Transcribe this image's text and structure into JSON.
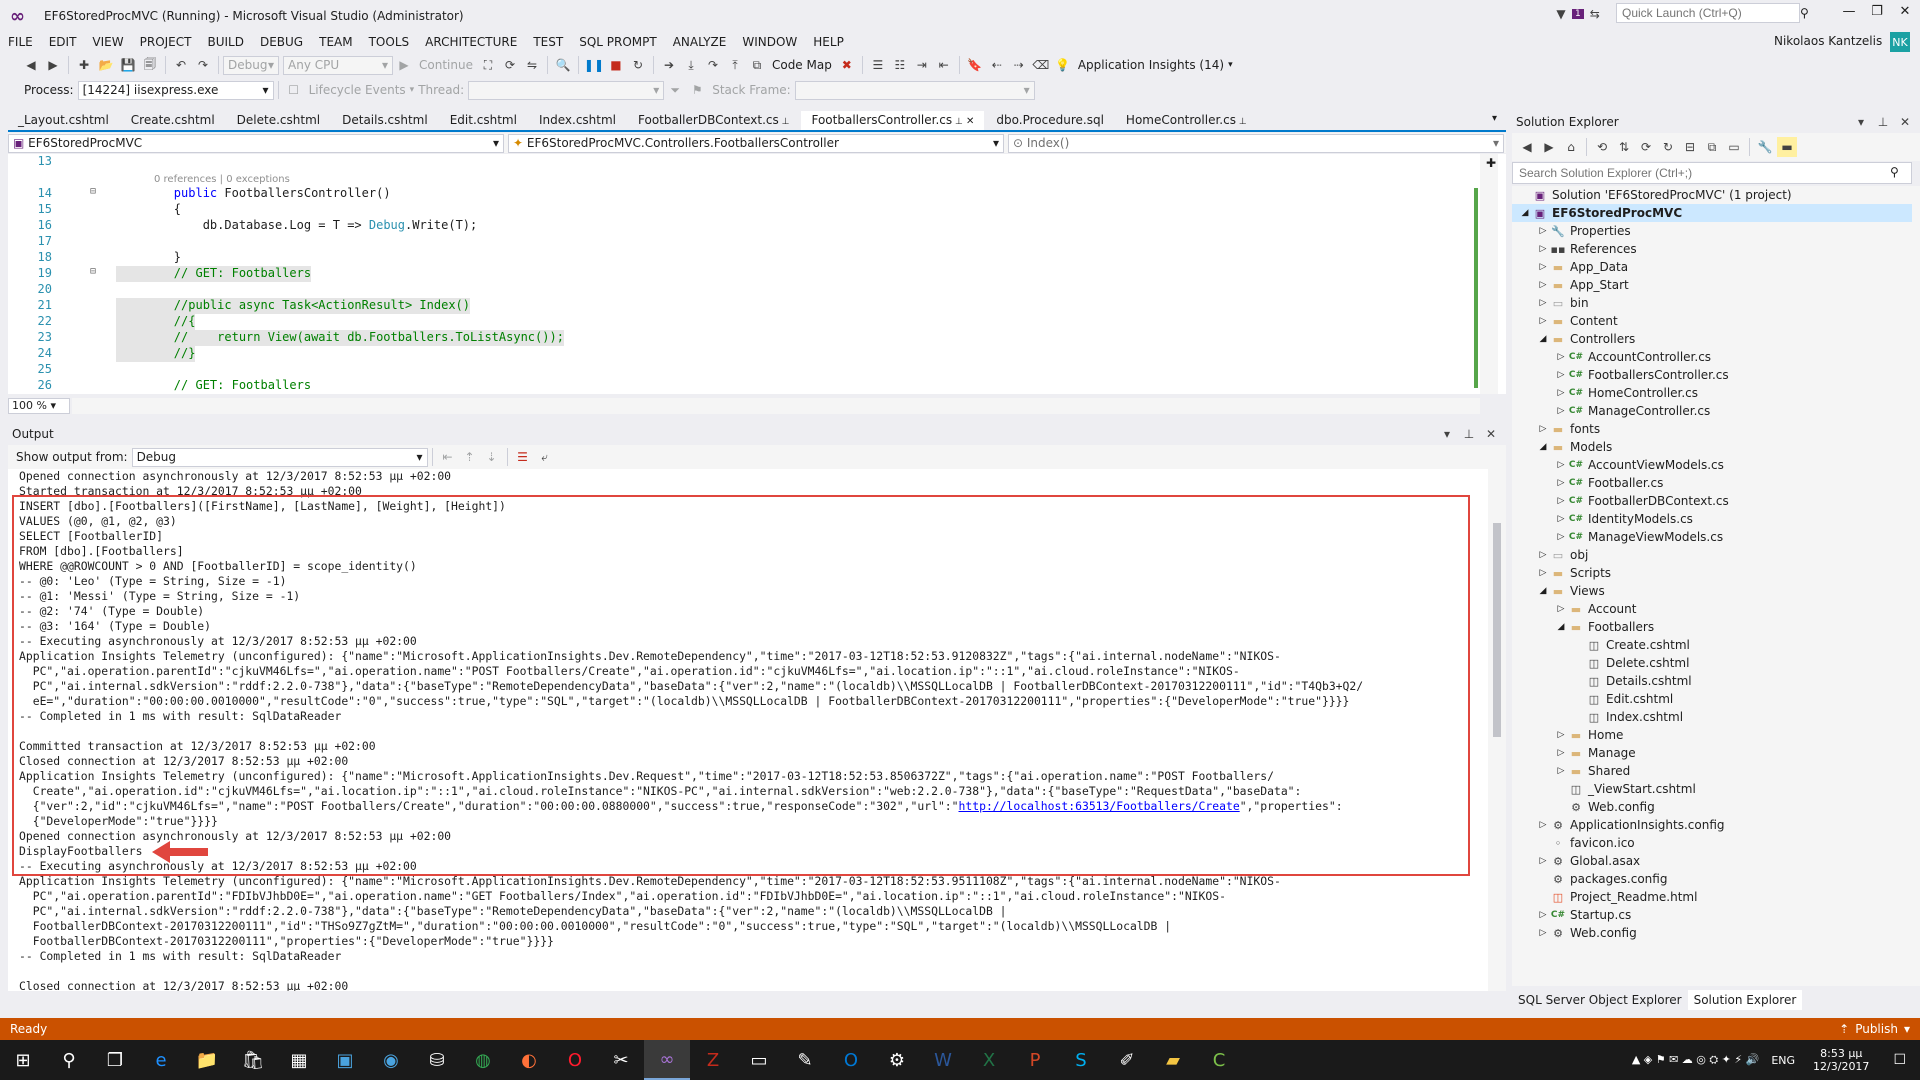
{
  "window": {
    "title": "EF6StoredProcMVC (Running) - Microsoft Visual Studio (Administrator)",
    "notification_count": "1",
    "quick_launch_placeholder": "Quick Launch (Ctrl+Q)",
    "user_name": "Nikolaos Kantzelis",
    "user_initials": "NK"
  },
  "menu": [
    "FILE",
    "EDIT",
    "VIEW",
    "PROJECT",
    "BUILD",
    "DEBUG",
    "TEAM",
    "TOOLS",
    "ARCHITECTURE",
    "TEST",
    "SQL PROMPT",
    "ANALYZE",
    "WINDOW",
    "HELP"
  ],
  "toolbar": {
    "config": "Debug",
    "platform": "Any CPU",
    "continue_label": "Continue",
    "code_map_label": "Code Map",
    "app_insights_label": "Application Insights (14)",
    "process_label": "Process:",
    "process_value": "[14224] iisexpress.exe",
    "lifecycle_label": "Lifecycle Events",
    "thread_label": "Thread:",
    "stack_frame_label": "Stack Frame:"
  },
  "doc_tabs": [
    "_Layout.cshtml",
    "Create.cshtml",
    "Delete.cshtml",
    "Details.cshtml",
    "Edit.cshtml",
    "Index.cshtml",
    "FootballerDBContext.cs",
    "FootballersController.cs",
    "dbo.Procedure.sql",
    "HomeController.cs"
  ],
  "nav": {
    "project": "EF6StoredProcMVC",
    "class": "EF6StoredProcMVC.Controllers.FootballersController",
    "member": "Index()"
  },
  "code": {
    "lens": "0 references | 0 exceptions",
    "lines": [
      {
        "n": "13",
        "text": ""
      },
      {
        "n": "14",
        "text": "        public FootballersController()"
      },
      {
        "n": "15",
        "text": "        {"
      },
      {
        "n": "16",
        "text": "            db.Database.Log = T => Debug.Write(T);"
      },
      {
        "n": "17",
        "text": ""
      },
      {
        "n": "18",
        "text": "        }"
      },
      {
        "n": "19",
        "text": "        // GET: Footballers"
      },
      {
        "n": "20",
        "text": ""
      },
      {
        "n": "21",
        "text": "        //public async Task<ActionResult> Index()"
      },
      {
        "n": "22",
        "text": "        //{"
      },
      {
        "n": "23",
        "text": "        //    return View(await db.Footballers.ToListAsync());"
      },
      {
        "n": "24",
        "text": "        //}"
      },
      {
        "n": "25",
        "text": ""
      },
      {
        "n": "26",
        "text": "        // GET: Footballers"
      }
    ],
    "zoom": "100 %"
  },
  "output": {
    "title": "Output",
    "show_from_label": "Show output from:",
    "source": "Debug",
    "lines": [
      "Opened connection asynchronously at 12/3/2017 8:52:53 μμ +02:00",
      "Started transaction at 12/3/2017 8:52:53 μμ +02:00",
      "INSERT [dbo].[Footballers]([FirstName], [LastName], [Weight], [Height])",
      "VALUES (@0, @1, @2, @3)",
      "SELECT [FootballerID]",
      "FROM [dbo].[Footballers]",
      "WHERE @@ROWCOUNT > 0 AND [FootballerID] = scope_identity()",
      "-- @0: 'Leo' (Type = String, Size = -1)",
      "-- @1: 'Messi' (Type = String, Size = -1)",
      "-- @2: '74' (Type = Double)",
      "-- @3: '164' (Type = Double)",
      "-- Executing asynchronously at 12/3/2017 8:52:53 μμ +02:00",
      "Application Insights Telemetry (unconfigured): {\"name\":\"Microsoft.ApplicationInsights.Dev.RemoteDependency\",\"time\":\"2017-03-12T18:52:53.9120832Z\",\"tags\":{\"ai.internal.nodeName\":\"NIKOS-",
      "  PC\",\"ai.operation.parentId\":\"cjkuVM46Lfs=\",\"ai.operation.name\":\"POST Footballers/Create\",\"ai.operation.id\":\"cjkuVM46Lfs=\",\"ai.location.ip\":\"::1\",\"ai.cloud.roleInstance\":\"NIKOS-",
      "  PC\",\"ai.internal.sdkVersion\":\"rddf:2.2.0-738\"},\"data\":{\"baseType\":\"RemoteDependencyData\",\"baseData\":{\"ver\":2,\"name\":\"(localdb)\\\\MSSQLLocalDB | FootballerDBContext-20170312200111\",\"id\":\"T4Qb3+Q2/",
      "  eE=\",\"duration\":\"00:00:00.0010000\",\"resultCode\":\"0\",\"success\":true,\"type\":\"SQL\",\"target\":\"(localdb)\\\\MSSQLLocalDB | FootballerDBContext-20170312200111\",\"properties\":{\"DeveloperMode\":\"true\"}}}}",
      "-- Completed in 1 ms with result: SqlDataReader",
      "",
      "Committed transaction at 12/3/2017 8:52:53 μμ +02:00",
      "Closed connection at 12/3/2017 8:52:53 μμ +02:00",
      "Application Insights Telemetry (unconfigured): {\"name\":\"Microsoft.ApplicationInsights.Dev.Request\",\"time\":\"2017-03-12T18:52:53.8506372Z\",\"tags\":{\"ai.operation.name\":\"POST Footballers/",
      "  Create\",\"ai.operation.id\":\"cjkuVM46Lfs=\",\"ai.location.ip\":\"::1\",\"ai.cloud.roleInstance\":\"NIKOS-PC\",\"ai.internal.sdkVersion\":\"web:2.2.0-738\"},\"data\":{\"baseType\":\"RequestData\",\"baseData\":",
      "  {\"ver\":2,\"id\":\"cjkuVM46Lfs=\",\"name\":\"POST Footballers/Create\",\"duration\":\"00:00:00.0880000\",\"success\":true,\"responseCode\":\"302\",\"url\":\"",
      "  {\"DeveloperMode\":\"true\"}}}}",
      "Opened connection asynchronously at 12/3/2017 8:52:53 μμ +02:00",
      "DisplayFootballers",
      "-- Executing asynchronously at 12/3/2017 8:52:53 μμ +02:00",
      "Application Insights Telemetry (unconfigured): {\"name\":\"Microsoft.ApplicationInsights.Dev.RemoteDependency\",\"time\":\"2017-03-12T18:52:53.9511108Z\",\"tags\":{\"ai.internal.nodeName\":\"NIKOS-",
      "  PC\",\"ai.operation.parentId\":\"FDIbVJhbD0E=\",\"ai.operation.name\":\"GET Footballers/Index\",\"ai.operation.id\":\"FDIbVJhbD0E=\",\"ai.location.ip\":\"::1\",\"ai.cloud.roleInstance\":\"NIKOS-",
      "  PC\",\"ai.internal.sdkVersion\":\"rddf:2.2.0-738\"},\"data\":{\"baseType\":\"RemoteDependencyData\",\"baseData\":{\"ver\":2,\"name\":\"(localdb)\\\\MSSQLLocalDB |",
      "  FootballerDBContext-20170312200111\",\"id\":\"THSo9Z7gZtM=\",\"duration\":\"00:00:00.0010000\",\"resultCode\":\"0\",\"success\":true,\"type\":\"SQL\",\"target\":\"(localdb)\\\\MSSQLLocalDB |",
      "  FootballerDBContext-20170312200111\",\"properties\":{\"DeveloperMode\":\"true\"}}}}",
      "-- Completed in 1 ms with result: SqlDataReader",
      "",
      "Closed connection at 12/3/2017 8:52:53 μμ +02:00"
    ],
    "link_text": "http://localhost:63513/Footballers/Create",
    "link_suffix": "\",\"properties\":"
  },
  "solution_explorer": {
    "title": "Solution Explorer",
    "search_placeholder": "Search Solution Explorer (Ctrl+;)",
    "tree": [
      {
        "label": "Solution 'EF6StoredProcMVC' (1 project)",
        "depth": 0,
        "arrow": "",
        "icon": "solution"
      },
      {
        "label": "EF6StoredProcMVC",
        "depth": 0,
        "arrow": "open",
        "icon": "project",
        "selected": true
      },
      {
        "label": "Properties",
        "depth": 1,
        "arrow": "closed",
        "icon": "wrench"
      },
      {
        "label": "References",
        "depth": 1,
        "arrow": "closed",
        "icon": "refs"
      },
      {
        "label": "App_Data",
        "depth": 1,
        "arrow": "closed",
        "icon": "folder"
      },
      {
        "label": "App_Start",
        "depth": 1,
        "arrow": "closed",
        "icon": "folder"
      },
      {
        "label": "bin",
        "depth": 1,
        "arrow": "closed",
        "icon": "folder-hidden"
      },
      {
        "label": "Content",
        "depth": 1,
        "arrow": "closed",
        "icon": "folder"
      },
      {
        "label": "Controllers",
        "depth": 1,
        "arrow": "open",
        "icon": "folder"
      },
      {
        "label": "AccountController.cs",
        "depth": 2,
        "arrow": "closed",
        "icon": "cs"
      },
      {
        "label": "FootballersController.cs",
        "depth": 2,
        "arrow": "closed",
        "icon": "cs"
      },
      {
        "label": "HomeController.cs",
        "depth": 2,
        "arrow": "closed",
        "icon": "cs"
      },
      {
        "label": "ManageController.cs",
        "depth": 2,
        "arrow": "closed",
        "icon": "cs"
      },
      {
        "label": "fonts",
        "depth": 1,
        "arrow": "closed",
        "icon": "folder"
      },
      {
        "label": "Models",
        "depth": 1,
        "arrow": "open",
        "icon": "folder"
      },
      {
        "label": "AccountViewModels.cs",
        "depth": 2,
        "arrow": "closed",
        "icon": "cs"
      },
      {
        "label": "Footballer.cs",
        "depth": 2,
        "arrow": "closed",
        "icon": "cs"
      },
      {
        "label": "FootballerDBContext.cs",
        "depth": 2,
        "arrow": "closed",
        "icon": "cs"
      },
      {
        "label": "IdentityModels.cs",
        "depth": 2,
        "arrow": "closed",
        "icon": "cs"
      },
      {
        "label": "ManageViewModels.cs",
        "depth": 2,
        "arrow": "closed",
        "icon": "cs"
      },
      {
        "label": "obj",
        "depth": 1,
        "arrow": "closed",
        "icon": "folder-hidden"
      },
      {
        "label": "Scripts",
        "depth": 1,
        "arrow": "closed",
        "icon": "folder"
      },
      {
        "label": "Views",
        "depth": 1,
        "arrow": "open",
        "icon": "folder"
      },
      {
        "label": "Account",
        "depth": 2,
        "arrow": "closed",
        "icon": "folder"
      },
      {
        "label": "Footballers",
        "depth": 2,
        "arrow": "open",
        "icon": "folder"
      },
      {
        "label": "Create.cshtml",
        "depth": 3,
        "arrow": "",
        "icon": "cshtml"
      },
      {
        "label": "Delete.cshtml",
        "depth": 3,
        "arrow": "",
        "icon": "cshtml"
      },
      {
        "label": "Details.cshtml",
        "depth": 3,
        "arrow": "",
        "icon": "cshtml"
      },
      {
        "label": "Edit.cshtml",
        "depth": 3,
        "arrow": "",
        "icon": "cshtml"
      },
      {
        "label": "Index.cshtml",
        "depth": 3,
        "arrow": "",
        "icon": "cshtml"
      },
      {
        "label": "Home",
        "depth": 2,
        "arrow": "closed",
        "icon": "folder"
      },
      {
        "label": "Manage",
        "depth": 2,
        "arrow": "closed",
        "icon": "folder"
      },
      {
        "label": "Shared",
        "depth": 2,
        "arrow": "closed",
        "icon": "folder"
      },
      {
        "label": "_ViewStart.cshtml",
        "depth": 2,
        "arrow": "",
        "icon": "cshtml"
      },
      {
        "label": "Web.config",
        "depth": 2,
        "arrow": "",
        "icon": "config"
      },
      {
        "label": "ApplicationInsights.config",
        "depth": 1,
        "arrow": "closed",
        "icon": "config"
      },
      {
        "label": "favicon.ico",
        "depth": 1,
        "arrow": "",
        "icon": "ico"
      },
      {
        "label": "Global.asax",
        "depth": 1,
        "arrow": "closed",
        "icon": "config"
      },
      {
        "label": "packages.config",
        "depth": 1,
        "arrow": "",
        "icon": "config"
      },
      {
        "label": "Project_Readme.html",
        "depth": 1,
        "arrow": "",
        "icon": "html"
      },
      {
        "label": "Startup.cs",
        "depth": 1,
        "arrow": "closed",
        "icon": "cs"
      },
      {
        "label": "Web.config",
        "depth": 1,
        "arrow": "closed",
        "icon": "config"
      }
    ],
    "bottom_tabs": [
      "SQL Server Object Explorer",
      "Solution Explorer"
    ]
  },
  "status": {
    "text": "Ready",
    "publish": "Publish"
  },
  "taskbar": {
    "language": "ENG",
    "time": "8:53 μμ",
    "date": "12/3/2017"
  },
  "colors": {
    "accent": "#007acc",
    "status_bar": "#ca5100",
    "highlight_box": "#e0463e"
  }
}
